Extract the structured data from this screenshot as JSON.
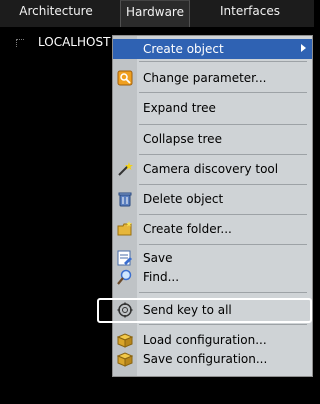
{
  "tabs": [
    {
      "label": "Architecture"
    },
    {
      "label": "Hardware",
      "active": true
    },
    {
      "label": "Interfaces"
    }
  ],
  "tree": {
    "root_label": "LOCALHOST [COMPUTER]"
  },
  "context_menu": {
    "create_object": "Create object",
    "change_parameter": "Change parameter...",
    "expand_tree": "Expand tree",
    "collapse_tree": "Collapse tree",
    "camera_discovery": "Camera discovery tool",
    "delete_object": "Delete object",
    "create_folder": "Create folder...",
    "save": "Save",
    "find": "Find...",
    "send_key": "Send key to all",
    "load_config": "Load configuration...",
    "save_config": "Save configuration..."
  },
  "colors": {
    "highlight": "#2f62b3",
    "menu_bg": "#cfd3d6",
    "tab_bar": "#1c1c1c"
  }
}
